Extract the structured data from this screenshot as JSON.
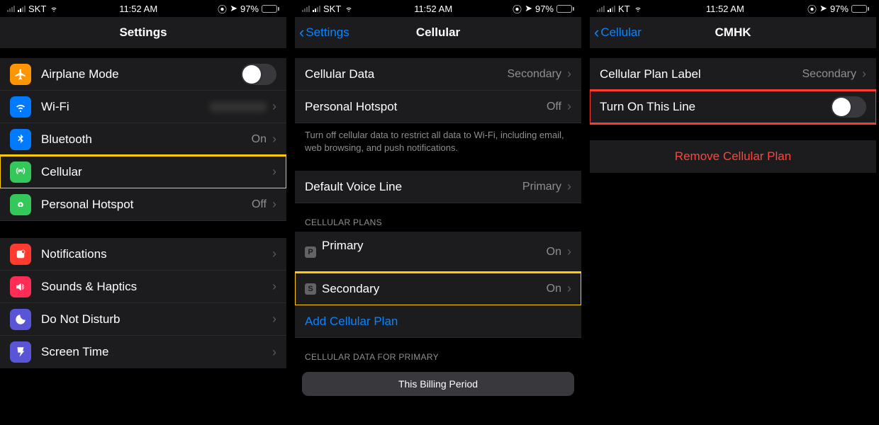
{
  "status": {
    "time": "11:52 AM",
    "batteryPct": "97%"
  },
  "screens": [
    {
      "carrier": "SKT",
      "nav": {
        "title": "Settings",
        "back": null
      },
      "groups": [
        {
          "rows": [
            {
              "name": "airplane-mode",
              "icon": "airplane-icon",
              "iconColor": "ic-orange",
              "label": "Airplane Mode",
              "control": "toggle",
              "toggleOn": false
            },
            {
              "name": "wifi",
              "icon": "wifi-icon",
              "iconColor": "ic-blue",
              "label": "Wi-Fi",
              "value": "",
              "valueBlurred": true,
              "chevron": true
            },
            {
              "name": "bluetooth",
              "icon": "bluetooth-icon",
              "iconColor": "ic-blue",
              "label": "Bluetooth",
              "value": "On",
              "chevron": true
            },
            {
              "name": "cellular",
              "icon": "cellular-icon",
              "iconColor": "ic-green",
              "label": "Cellular",
              "chevron": true,
              "highlight": "yellow"
            },
            {
              "name": "personal-hotspot",
              "icon": "hotspot-icon",
              "iconColor": "ic-green",
              "label": "Personal Hotspot",
              "value": "Off",
              "chevron": true
            }
          ]
        },
        {
          "rows": [
            {
              "name": "notifications",
              "icon": "notifications-icon",
              "iconColor": "ic-red",
              "label": "Notifications",
              "chevron": true
            },
            {
              "name": "sounds-haptics",
              "icon": "sounds-icon",
              "iconColor": "ic-pink",
              "label": "Sounds & Haptics",
              "chevron": true
            },
            {
              "name": "do-not-disturb",
              "icon": "dnd-icon",
              "iconColor": "ic-purple",
              "label": "Do Not Disturb",
              "chevron": true
            },
            {
              "name": "screen-time",
              "icon": "screentime-icon",
              "iconColor": "ic-purple",
              "label": "Screen Time",
              "chevron": true
            }
          ]
        }
      ]
    },
    {
      "carrier": "SKT",
      "nav": {
        "title": "Cellular",
        "back": "Settings"
      },
      "groups": [
        {
          "rows": [
            {
              "name": "cellular-data",
              "label": "Cellular Data",
              "value": "Secondary",
              "chevron": true
            },
            {
              "name": "personal-hotspot",
              "label": "Personal Hotspot",
              "value": "Off",
              "chevron": true
            }
          ],
          "footer": "Turn off cellular data to restrict all data to Wi-Fi, including email, web browsing, and push notifications."
        },
        {
          "rows": [
            {
              "name": "default-voice-line",
              "label": "Default Voice Line",
              "value": "Primary",
              "chevron": true
            }
          ]
        },
        {
          "header": "CELLULAR PLANS",
          "rows": [
            {
              "name": "plan-primary",
              "simBadge": "P",
              "label": "Primary",
              "sublabel": "",
              "value": "On",
              "chevron": true
            },
            {
              "name": "plan-secondary",
              "simBadge": "S",
              "label": "Secondary",
              "value": "On",
              "chevron": true,
              "highlight": "yellow"
            },
            {
              "name": "add-cellular-plan",
              "label": "Add Cellular Plan",
              "link": true
            }
          ]
        },
        {
          "header": "CELLULAR DATA FOR PRIMARY",
          "segmented": "This Billing Period"
        }
      ]
    },
    {
      "carrier": "KT",
      "nav": {
        "title": "CMHK",
        "back": "Cellular"
      },
      "groups": [
        {
          "rows": [
            {
              "name": "cellular-plan-label",
              "label": "Cellular Plan Label",
              "value": "Secondary",
              "chevron": true
            },
            {
              "name": "turn-on-this-line",
              "label": "Turn On This Line",
              "control": "toggle",
              "toggleOn": false,
              "highlight": "red"
            }
          ]
        },
        {
          "rows": [
            {
              "name": "remove-cellular-plan",
              "label": "Remove Cellular Plan",
              "danger": true
            }
          ]
        }
      ]
    }
  ]
}
